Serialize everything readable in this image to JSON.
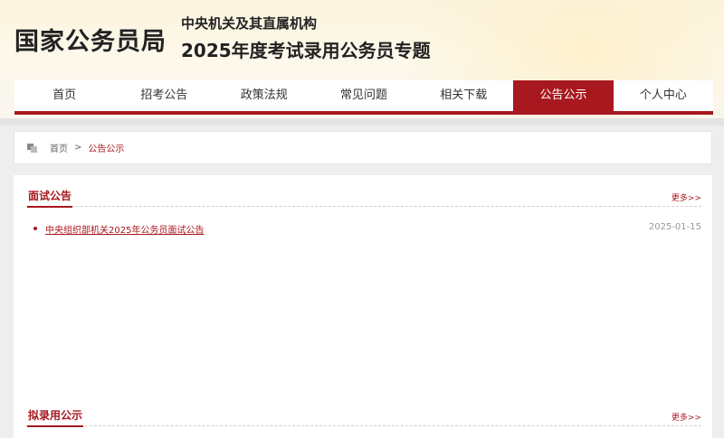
{
  "header": {
    "site_title": "国家公务员局",
    "subtitle_line1": "中央机关及其直属机构",
    "subtitle_line2": "2025年度考试录用公务员专题"
  },
  "nav": {
    "items": [
      {
        "label": "首页"
      },
      {
        "label": "招考公告"
      },
      {
        "label": "政策法规"
      },
      {
        "label": "常见问题"
      },
      {
        "label": "相关下载"
      },
      {
        "label": "公告公示",
        "active": true
      },
      {
        "label": "个人中心"
      }
    ]
  },
  "breadcrumb": {
    "home": "首页",
    "separator": ">",
    "current": "公告公示"
  },
  "sections": [
    {
      "title": "面试公告",
      "more": "更多>>",
      "items": [
        {
          "title": "中央组织部机关2025年公务员面试公告",
          "date": "2025-01-15"
        }
      ]
    },
    {
      "title": "拟录用公示",
      "more": "更多>>",
      "items": []
    }
  ],
  "colors": {
    "accent": "#a8181f",
    "header_bg": "#fbf3dc",
    "page_bg": "#eeeeee"
  }
}
